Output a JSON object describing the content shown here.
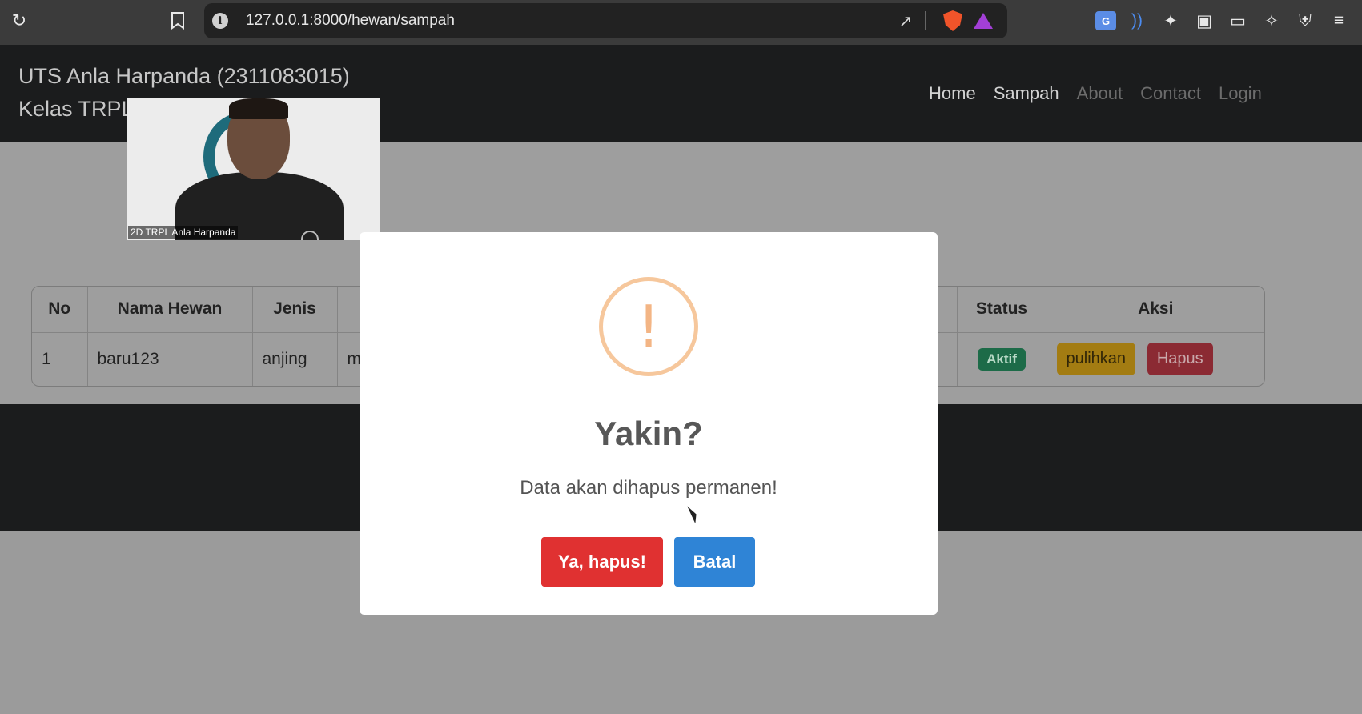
{
  "browser": {
    "url": "127.0.0.1:8000/hewan/sampah",
    "icons": [
      "reload-icon",
      "bookmark-icon",
      "info-icon",
      "share-icon",
      "brave-shield-icon",
      "brave-rewards-icon",
      "translate-icon",
      "audio-icon",
      "extensions-icon",
      "sidebar-icon",
      "wallet-icon",
      "leo-ai-icon",
      "vpn-shield-icon",
      "menu-icon"
    ],
    "colors": {
      "brave": "#f0542a",
      "rewards": "#a23fd6",
      "translate": "#5b8de6"
    }
  },
  "navbar": {
    "brand_line1": "UTS Anla Harpanda (2311083015)",
    "brand_line2": "Kelas TRPL",
    "links": [
      {
        "label": "Home",
        "active": true
      },
      {
        "label": "Sampah",
        "active": true
      },
      {
        "label": "About",
        "active": false
      },
      {
        "label": "Contact",
        "active": false
      },
      {
        "label": "Login",
        "active": false
      }
    ]
  },
  "table": {
    "headers": [
      "No",
      "Nama Hewan",
      "Jenis",
      "",
      "Status",
      "Aksi"
    ],
    "rows": [
      {
        "no": "1",
        "nama": "baru123",
        "jenis": "anjing",
        "partial": "m",
        "status": "Aktif",
        "restore_label": "pulihkan",
        "delete_label": "Hapus"
      }
    ]
  },
  "webcam": {
    "label": "2D TRPL Anla Harpanda"
  },
  "modal": {
    "icon": "!",
    "title": "Yakin?",
    "text": "Data akan dihapus permanen!",
    "confirm_label": "Ya, hapus!",
    "cancel_label": "Batal",
    "colors": {
      "confirm": "#e03131",
      "cancel": "#2f84d6",
      "warning": "#f6c79c"
    }
  }
}
